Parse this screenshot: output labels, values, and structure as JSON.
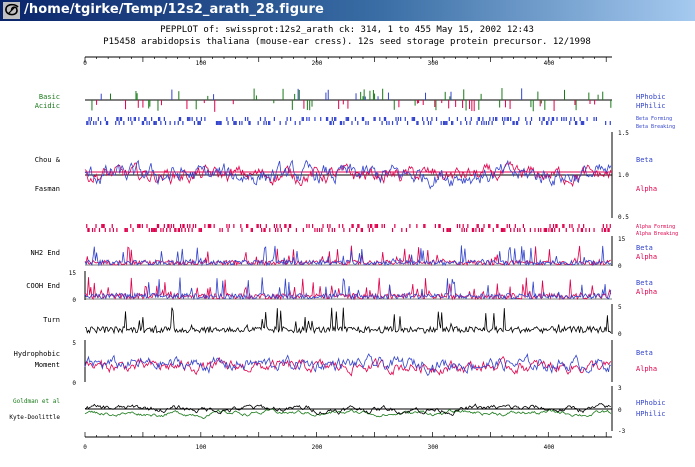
{
  "window": {
    "title": "/home/tgirke/Temp/12s2_arath_28.figure",
    "icon": "x11-swirl-icon"
  },
  "header": {
    "line1": "PEPPLOT of: swissprot:12s2_arath ck: 314,  1 to 455  May 15, 2002 12:43",
    "line2": "P15458 arabidopsis thaliana (mouse-ear cress). 12s seed storage protein precursor. 12/1998"
  },
  "axis": {
    "ticks": [
      "0",
      "100",
      "200",
      "300",
      "400"
    ],
    "max_residue": 455
  },
  "colors": {
    "blue": "#3344cc",
    "red": "#e0004c",
    "green": "#1a7a1a",
    "black": "#000000"
  },
  "panels": {
    "charge": {
      "left_top": "Basic",
      "left_bottom": "Acidic",
      "right_top": "HPhobic",
      "right_bottom": "HPhilic"
    },
    "beta_strip": {
      "label_top": "Beta Forming",
      "label_bottom": "Beta Breaking"
    },
    "chou": {
      "left_top": "Chou &",
      "left_bottom": "Fasman",
      "right_top": "Beta",
      "right_bottom": "Alpha",
      "scale_top": "1.5",
      "scale_mid": "1.0",
      "scale_bottom": "0.5"
    },
    "alpha_strip": {
      "label_top": "Alpha Forming",
      "label_bottom": "Alpha Breaking"
    },
    "nh2": {
      "left": "NH2 End",
      "right_top": "Beta",
      "right_bottom": "Alpha",
      "scale_top": "15",
      "scale_bottom": "0"
    },
    "cooh": {
      "left": "COOH End",
      "right_top": "Beta",
      "right_bottom": "Alpha",
      "scale_left_top": "15",
      "scale_left_bottom": "0"
    },
    "turn": {
      "left": "Turn",
      "scale_top": "5",
      "scale_bottom": "0"
    },
    "moment": {
      "left_top": "Hydrophobic",
      "left_bottom": "Moment",
      "right_top": "Beta",
      "right_bottom": "Alpha",
      "scale_top": "5",
      "scale_bottom": "0"
    },
    "hydro": {
      "left_top": "Goldman et al",
      "left_bottom": "Kyte-Doolittle",
      "right_top": "HPhobic",
      "right_bottom": "HPhilic",
      "scale_top": "3",
      "scale_mid": "0",
      "scale_bottom": "-3"
    }
  }
}
